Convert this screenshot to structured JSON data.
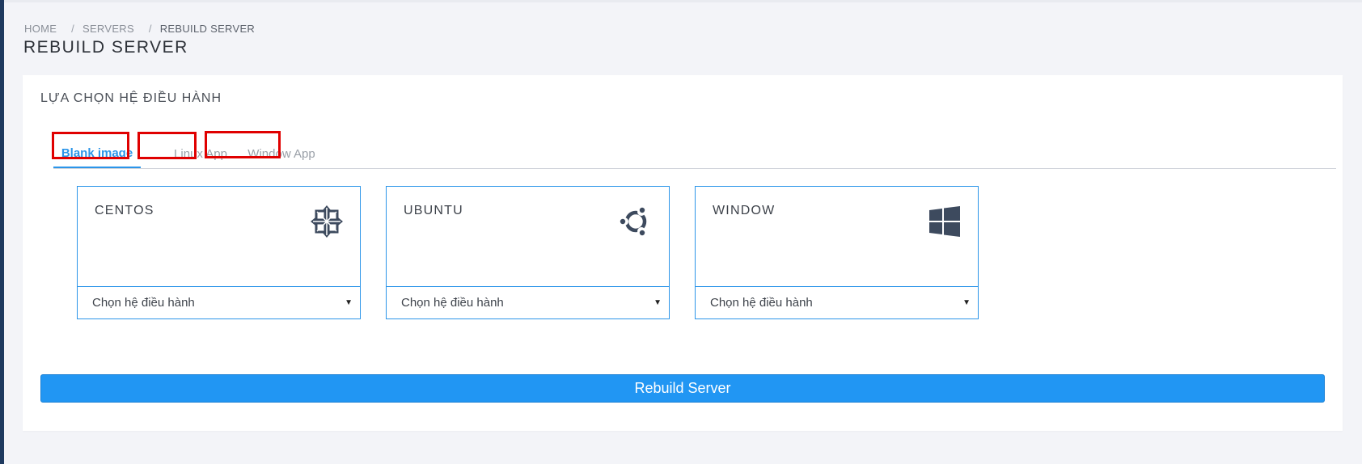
{
  "breadcrumb": {
    "home": "HOME",
    "servers": "SERVERS",
    "current": "REBUILD SERVER",
    "separator": "/"
  },
  "page_title": "REBUILD SERVER",
  "section_title": "LỰA CHỌN HỆ ĐIỀU HÀNH",
  "tabs": [
    {
      "label": "Blank image",
      "active": true
    },
    {
      "label": "Linux App",
      "active": false
    },
    {
      "label": "Window App",
      "active": false
    }
  ],
  "os_cards": [
    {
      "name": "CENTOS",
      "icon": "centos-icon",
      "select_value": "Chọn hệ điều hành"
    },
    {
      "name": "UBUNTU",
      "icon": "ubuntu-icon",
      "select_value": "Chọn hệ điều hành"
    },
    {
      "name": "WINDOW",
      "icon": "windows-icon",
      "select_value": "Chọn hệ điều hành"
    }
  ],
  "rebuild_button": "Rebuild Server",
  "colors": {
    "accent": "#2196f3",
    "highlight_box": "#e00000",
    "sidebar": "#1f3a5f"
  }
}
